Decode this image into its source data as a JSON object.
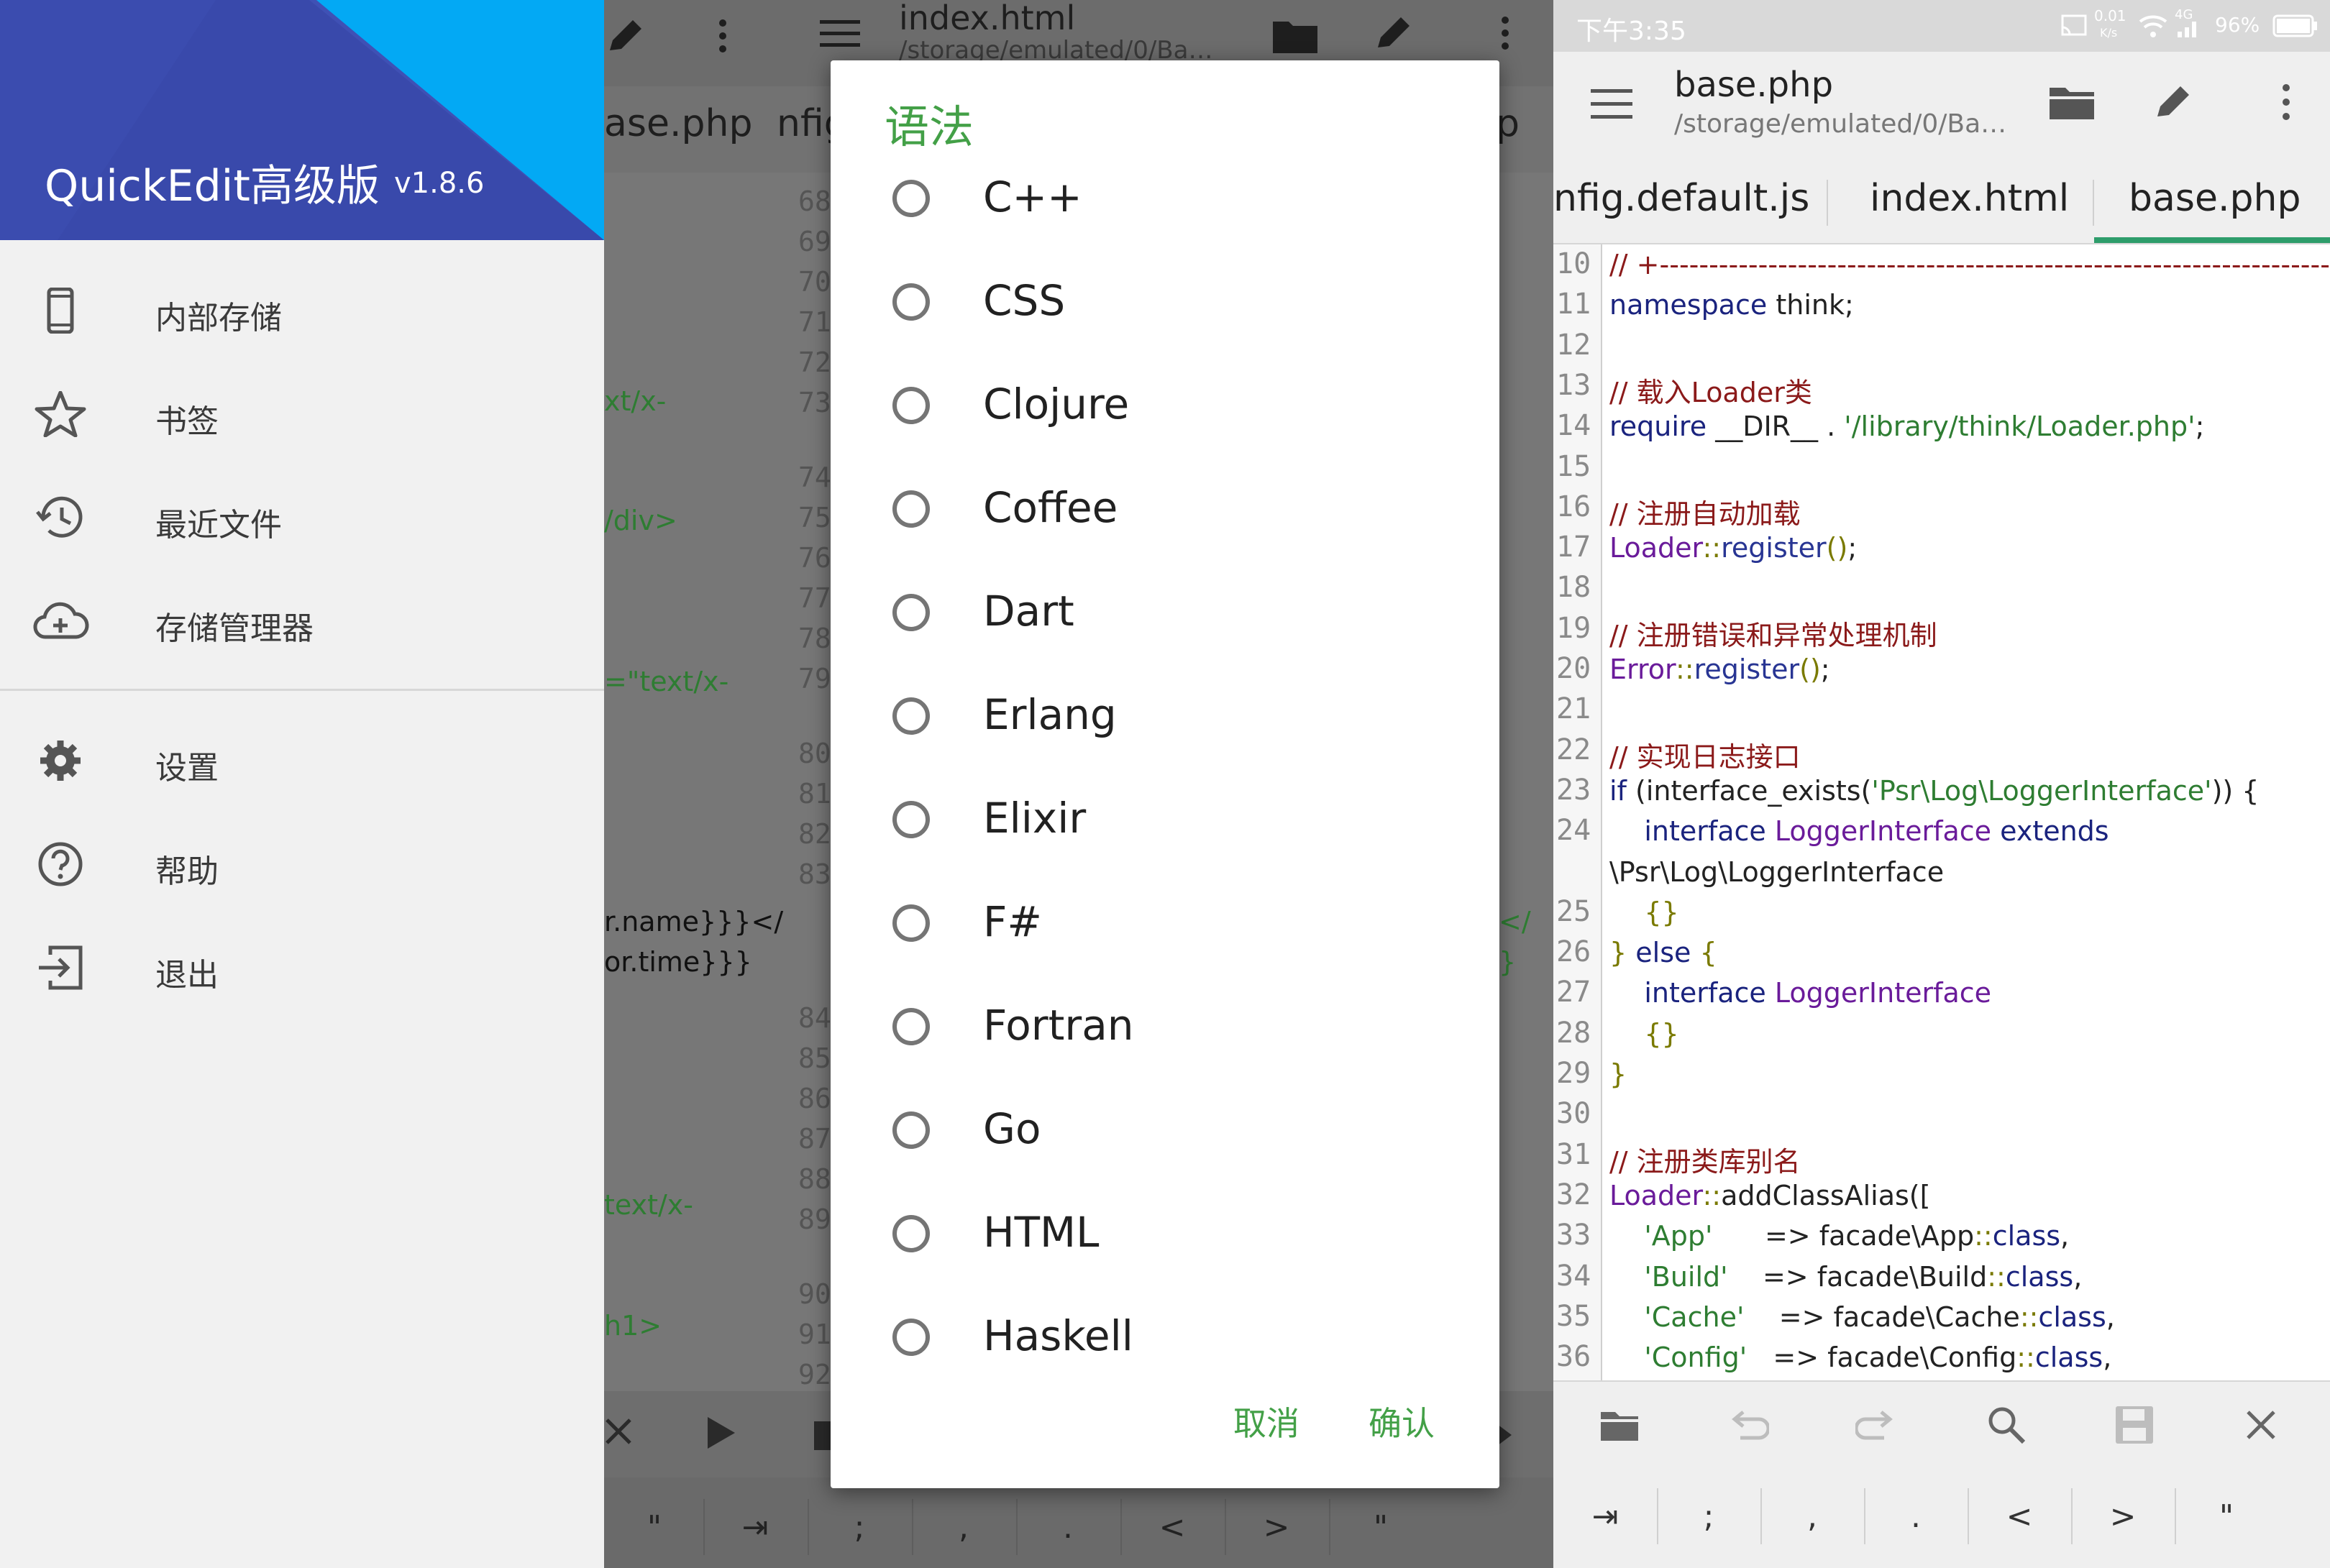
{
  "drawer": {
    "app_title": "QuickEdit高级版",
    "version": "v1.8.6",
    "items": [
      {
        "label": "内部存储",
        "icon": "phone-icon"
      },
      {
        "label": "书签",
        "icon": "star-icon"
      },
      {
        "label": "最近文件",
        "icon": "history-icon"
      },
      {
        "label": "存储管理器",
        "icon": "cloud-add-icon"
      },
      {
        "label": "设置",
        "icon": "gear-icon"
      },
      {
        "label": "帮助",
        "icon": "help-icon"
      },
      {
        "label": "退出",
        "icon": "exit-icon"
      }
    ]
  },
  "middle": {
    "toolbar": {
      "filename": "index.html",
      "path": "/storage/emulated/0/Ba…"
    },
    "tabs": [
      "ase.php",
      "nfig",
      "p"
    ],
    "line_numbers": [
      "68",
      "69",
      "70",
      "71",
      "72",
      "73",
      "74",
      "75",
      "76",
      "77",
      "78",
      "79",
      "80",
      "81",
      "82",
      "83",
      "84",
      "85",
      "86",
      "87",
      "88",
      "89",
      "90",
      "91",
      "92"
    ],
    "code_fragments": [
      {
        "text": "xt/x-",
        "color": "#2e7d32"
      },
      {
        "text": "/div>",
        "color": "#2e7d32"
      },
      {
        "text": "=\"text/x-",
        "color": "#2e7d32"
      },
      {
        "text": "r.name}}}</",
        "color": "#111111"
      },
      {
        "text": "or.time}}}",
        "color": "#111111"
      },
      {
        "text": "text/x-",
        "color": "#2e7d32"
      },
      {
        "text": "h1>",
        "color": "#2e7d32"
      }
    ],
    "right_fragments": [
      "</",
      "}"
    ],
    "keys": [
      "\"",
      "⇥",
      ";",
      ",",
      ".",
      "<",
      ">",
      "\""
    ]
  },
  "dialog": {
    "title": "语法",
    "options": [
      "C++",
      "CSS",
      "Clojure",
      "Coffee",
      "Dart",
      "Erlang",
      "Elixir",
      "F#",
      "Fortran",
      "Go",
      "HTML",
      "Haskell"
    ],
    "cancel_label": "取消",
    "confirm_label": "确认",
    "accent_color": "#43a047"
  },
  "right": {
    "status": {
      "time": "下午3:35",
      "net_speed": "0.01",
      "net_unit": "K/s",
      "network": "4G",
      "battery": "96%"
    },
    "toolbar": {
      "filename": "base.php",
      "path": "/storage/emulated/0/Ba…"
    },
    "tabs": [
      {
        "label": "nfig.default.js",
        "active": false
      },
      {
        "label": "index.html",
        "active": false
      },
      {
        "label": "base.php",
        "active": true
      }
    ],
    "code_lines": [
      {
        "n": "10",
        "segs": [
          {
            "c": "cm",
            "t": "// +----------------------------------------------------------------------"
          }
        ]
      },
      {
        "n": "11",
        "segs": [
          {
            "c": "kw",
            "t": "namespace"
          },
          {
            "c": "",
            "t": " think;"
          }
        ]
      },
      {
        "n": "12",
        "segs": []
      },
      {
        "n": "13",
        "segs": [
          {
            "c": "cm",
            "t": "// 载入Loader类"
          }
        ]
      },
      {
        "n": "14",
        "segs": [
          {
            "c": "kw",
            "t": "require"
          },
          {
            "c": "",
            "t": " __DIR__ . "
          },
          {
            "c": "st",
            "t": "'/library/think/Loader.php'"
          },
          {
            "c": "",
            "t": ";"
          }
        ]
      },
      {
        "n": "15",
        "segs": []
      },
      {
        "n": "16",
        "segs": [
          {
            "c": "cm",
            "t": "// 注册自动加载"
          }
        ]
      },
      {
        "n": "17",
        "segs": [
          {
            "c": "cls",
            "t": "Loader"
          },
          {
            "c": "pu",
            "t": "::"
          },
          {
            "c": "fn",
            "t": "register"
          },
          {
            "c": "pu",
            "t": "()"
          },
          {
            "c": "",
            "t": ";"
          }
        ]
      },
      {
        "n": "18",
        "segs": []
      },
      {
        "n": "19",
        "segs": [
          {
            "c": "cm",
            "t": "// 注册错误和异常处理机制"
          }
        ]
      },
      {
        "n": "20",
        "segs": [
          {
            "c": "cls",
            "t": "Error"
          },
          {
            "c": "pu",
            "t": "::"
          },
          {
            "c": "fn",
            "t": "register"
          },
          {
            "c": "pu",
            "t": "()"
          },
          {
            "c": "",
            "t": ";"
          }
        ]
      },
      {
        "n": "21",
        "segs": []
      },
      {
        "n": "22",
        "segs": [
          {
            "c": "cm",
            "t": "// 实现日志接口"
          }
        ]
      },
      {
        "n": "23",
        "segs": [
          {
            "c": "kw",
            "t": "if"
          },
          {
            "c": "",
            "t": " (interface_exists("
          },
          {
            "c": "st",
            "t": "'Psr\\Log\\LoggerInterface'"
          },
          {
            "c": "",
            "t": ")) {"
          }
        ]
      },
      {
        "n": "24",
        "segs": [
          {
            "c": "",
            "t": "    "
          },
          {
            "c": "kw",
            "t": "interface"
          },
          {
            "c": "",
            "t": " "
          },
          {
            "c": "cls",
            "t": "LoggerInterface"
          },
          {
            "c": "",
            "t": " "
          },
          {
            "c": "kw",
            "t": "extends"
          }
        ]
      },
      {
        "n": "",
        "segs": [
          {
            "c": "",
            "t": "\\Psr\\Log\\LoggerInterface"
          }
        ]
      },
      {
        "n": "25",
        "segs": [
          {
            "c": "",
            "t": "    "
          },
          {
            "c": "pu",
            "t": "{}"
          }
        ]
      },
      {
        "n": "26",
        "segs": [
          {
            "c": "pu",
            "t": "}"
          },
          {
            "c": "",
            "t": " "
          },
          {
            "c": "kw",
            "t": "else"
          },
          {
            "c": "",
            "t": " "
          },
          {
            "c": "pu",
            "t": "{"
          }
        ]
      },
      {
        "n": "27",
        "segs": [
          {
            "c": "",
            "t": "    "
          },
          {
            "c": "kw",
            "t": "interface"
          },
          {
            "c": "",
            "t": " "
          },
          {
            "c": "cls",
            "t": "LoggerInterface"
          }
        ]
      },
      {
        "n": "28",
        "segs": [
          {
            "c": "",
            "t": "    "
          },
          {
            "c": "pu",
            "t": "{}"
          }
        ]
      },
      {
        "n": "29",
        "segs": [
          {
            "c": "pu",
            "t": "}"
          }
        ]
      },
      {
        "n": "30",
        "segs": []
      },
      {
        "n": "31",
        "segs": [
          {
            "c": "cm",
            "t": "// 注册类库别名"
          }
        ]
      },
      {
        "n": "32",
        "segs": [
          {
            "c": "cls",
            "t": "Loader"
          },
          {
            "c": "pu",
            "t": "::"
          },
          {
            "c": "",
            "t": "addClassAlias(["
          }
        ]
      },
      {
        "n": "33",
        "segs": [
          {
            "c": "",
            "t": "    "
          },
          {
            "c": "st",
            "t": "'App'"
          },
          {
            "c": "",
            "t": "      => facade\\App"
          },
          {
            "c": "pu",
            "t": "::"
          },
          {
            "c": "kw",
            "t": "class"
          },
          {
            "c": "",
            "t": ","
          }
        ]
      },
      {
        "n": "34",
        "segs": [
          {
            "c": "",
            "t": "    "
          },
          {
            "c": "st",
            "t": "'Build'"
          },
          {
            "c": "",
            "t": "    => facade\\Build"
          },
          {
            "c": "pu",
            "t": "::"
          },
          {
            "c": "kw",
            "t": "class"
          },
          {
            "c": "",
            "t": ","
          }
        ]
      },
      {
        "n": "35",
        "segs": [
          {
            "c": "",
            "t": "    "
          },
          {
            "c": "st",
            "t": "'Cache'"
          },
          {
            "c": "",
            "t": "    => facade\\Cache"
          },
          {
            "c": "pu",
            "t": "::"
          },
          {
            "c": "kw",
            "t": "class"
          },
          {
            "c": "",
            "t": ","
          }
        ]
      },
      {
        "n": "36",
        "segs": [
          {
            "c": "",
            "t": "    "
          },
          {
            "c": "st",
            "t": "'Config'"
          },
          {
            "c": "",
            "t": "   => facade\\Config"
          },
          {
            "c": "pu",
            "t": "::"
          },
          {
            "c": "kw",
            "t": "class"
          },
          {
            "c": "",
            "t": ","
          }
        ]
      }
    ],
    "bottom_icons": [
      "folder-icon",
      "undo-icon",
      "redo-icon",
      "search-icon",
      "save-icon",
      "close-icon"
    ],
    "keys": [
      "⇥",
      ";",
      ",",
      ".",
      "<",
      ">",
      "\""
    ]
  }
}
